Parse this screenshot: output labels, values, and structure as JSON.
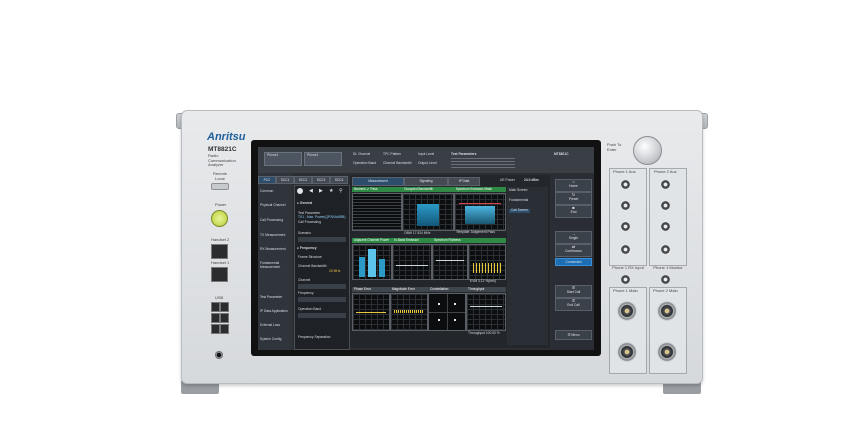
{
  "instrument": {
    "brand": "Anritsu",
    "model": "MT8821C",
    "subtitle": "Radio Communication Analyzer",
    "left_labels": {
      "remote": "Remote",
      "local": "Local",
      "power": "Power",
      "handset2": "Handset 2",
      "handset1": "Handset 1",
      "usb": "USB"
    },
    "right_labels": {
      "knob": "Push To Enter",
      "phone1_aux": "Phone 1 Aux",
      "phone2_aux": "Phone 2 Aux",
      "phone1_rx_input": "Phone 1 RX Input",
      "phone1_monitor": "Phone 1 Monitor",
      "phone1_main": "Phone 1 Main",
      "phone2_main": "Phone 2 Main"
    }
  },
  "screen": {
    "top_left": {
      "row1": "Phone1",
      "row2": "Phone1"
    },
    "channel_info": [
      "DL Channel",
      "Operation Band",
      "TPC Pattern",
      "Channel Bandwidth",
      "Input Level",
      "Output Level"
    ],
    "test_param_title": "Test Parameters",
    "model_badge": "MT8821C",
    "carrier_tabs": [
      "PCC",
      "SCC1",
      "SCC2",
      "SCC3",
      "SCC4"
    ],
    "left_menu": [
      "Common",
      "Physical Channel",
      "Call Processing",
      "TX Measurement",
      "RX Measurement",
      "Fundamental Measurement",
      "Test Parameter",
      "IP Data Application",
      "External Loss",
      "System Config"
    ],
    "param_sections": {
      "general": "General",
      "test_parameter_label": "Test Parameter",
      "test_parameter_value": "TX1 - Max. Power(QPSK/fullRB)",
      "call_processing": "Call Processing",
      "scenario": "Scenario",
      "frequency": "Frequency",
      "frame_structure": "Frame Structure",
      "channel_bandwidth": "Channel Bandwidth",
      "channel_bandwidth_value": "20 MHz",
      "channel": "Channel",
      "frequency_label": "Frequency",
      "operation_band": "Operation Band",
      "frequency_separation": "Frequency Separation"
    },
    "main_tabs": [
      "Measurement",
      "Signaling",
      "IP Data"
    ],
    "ue_power_label": "UE Power",
    "ue_power_value": "24.0 dBm",
    "meas_rows": [
      [
        "Numeric",
        "Occupied Bandwidth",
        "Spectrum Emission Mask"
      ],
      [
        "Adjacent Channel Power",
        "In-Band Emission",
        "Spectrum Flatness"
      ],
      [
        "Phase Error",
        "Magnitude Error",
        "Constellation",
        "Throughput"
      ]
    ],
    "pass_label": "Pass",
    "obw_readout": "OBW 17.924 MHz",
    "template_readout": "Template Judgement Pass",
    "evm_readout": "EVM 3.12 %(rms)",
    "throughput_readout": "Throughput 100.00 %",
    "side_list": [
      "Main Screen",
      "Fundamental",
      "Call Screen"
    ],
    "right_buttons": [
      "Home",
      "Preset",
      "End",
      "Single",
      "Continuous",
      "Connected",
      "Start Call",
      "End Call",
      "Menu"
    ],
    "right_num_label": "%\nRx"
  }
}
